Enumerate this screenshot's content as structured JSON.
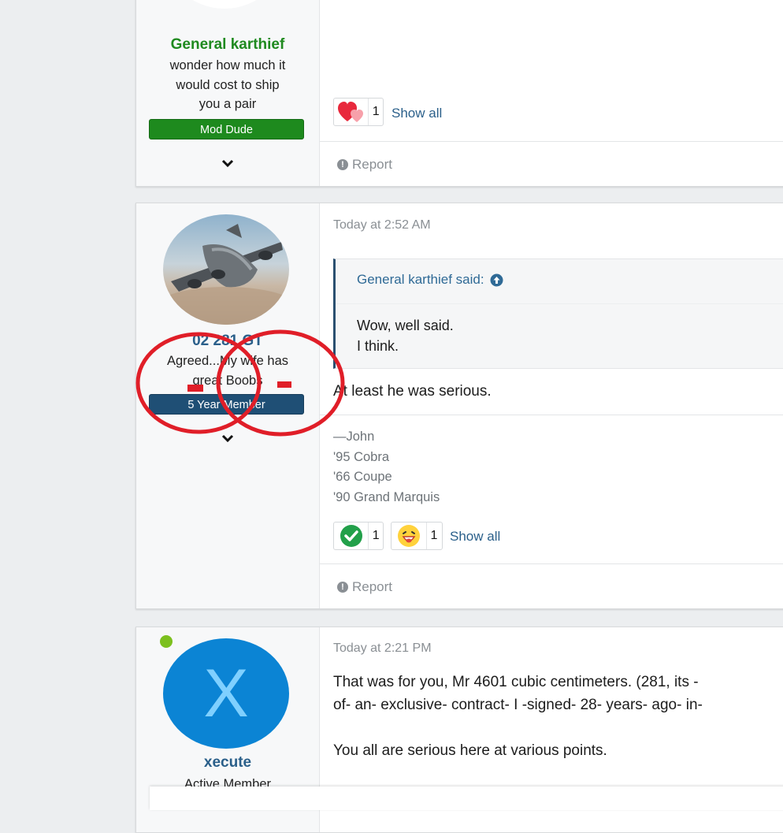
{
  "posts": [
    {
      "user": {
        "name": "General karthief",
        "title_lines": [
          "wonder how much it",
          "would cost to ship",
          "you a pair"
        ],
        "banner": "Mod Dude",
        "name_color": "#1f8a1f",
        "banner_color": "#1e8a1e"
      },
      "reactions": [
        {
          "icon": "heart-icon",
          "count": "1"
        }
      ],
      "show_all": "Show all",
      "report": "Report"
    },
    {
      "user": {
        "name": "02 281 GT",
        "title_lines": [
          "Agreed...My wife has",
          "great Boobs"
        ],
        "banner": "5 Year Member",
        "banner_color": "#1f4f75"
      },
      "timestamp": "Today at 2:52 AM",
      "quote": {
        "author": "General karthief said:",
        "lines": [
          "Wow, well said.",
          "I think."
        ]
      },
      "body": "At least he was serious.",
      "signature": [
        "—John",
        "'95 Cobra",
        "'66 Coupe",
        "'90 Grand Marquis"
      ],
      "reactions": [
        {
          "icon": "checkmark-icon",
          "count": "1"
        },
        {
          "icon": "grin-emoji-icon",
          "count": "1"
        }
      ],
      "show_all": "Show all",
      "report": "Report",
      "annotation_color": "#e01e28"
    },
    {
      "user": {
        "name": "xecute",
        "avatar_letter": "X",
        "title": "Active Member",
        "avatar_color": "#0b84d4",
        "online_color": "#7cc01e"
      },
      "timestamp": "Today at 2:21 PM",
      "body_lines": [
        "That was for you, Mr 4601 cubic centimeters. (281, its -",
        "of- an- exclusive- contract- I -signed- 28- years- ago- in-",
        "",
        "You all are serious here at various points."
      ]
    }
  ]
}
